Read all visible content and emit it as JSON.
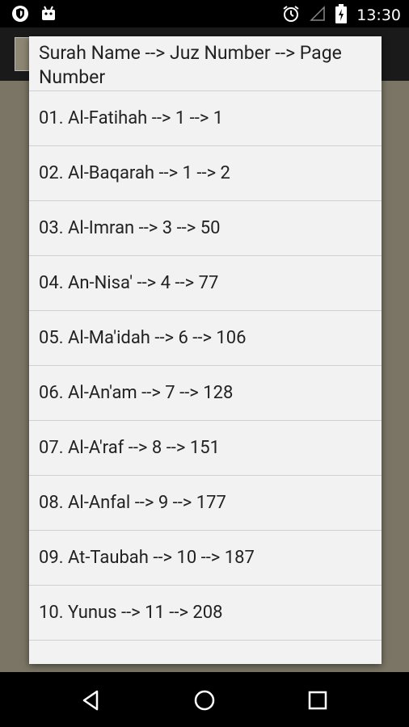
{
  "status_bar": {
    "time": "13:30",
    "left_icons": [
      "shield-icon",
      "android-icon"
    ],
    "right_icons": [
      "alarm-icon",
      "signal-icon",
      "battery-charging-icon"
    ]
  },
  "dialog": {
    "title": "Surah Name --> Juz Number --> Page Number",
    "items": [
      {
        "label": "01. Al-Fatihah --> 1 --> 1"
      },
      {
        "label": "02. Al-Baqarah --> 1 --> 2"
      },
      {
        "label": "03. Al-Imran --> 3 --> 50"
      },
      {
        "label": "04. An-Nisa' --> 4 --> 77"
      },
      {
        "label": "05. Al-Ma'idah --> 6 --> 106"
      },
      {
        "label": "06. Al-An'am --> 7 --> 128"
      },
      {
        "label": "07. Al-A'raf --> 8 --> 151"
      },
      {
        "label": "08. Al-Anfal --> 9 --> 177"
      },
      {
        "label": "09. At-Taubah --> 10 --> 187"
      },
      {
        "label": "10. Yunus --> 11 --> 208"
      }
    ]
  },
  "nav_bar": {
    "buttons": [
      "back-icon",
      "home-icon",
      "recents-icon"
    ]
  },
  "colors": {
    "background_dim": "#7a7565",
    "dialog_bg": "#f2f2f2",
    "divider": "#d0d0d0",
    "bars": "#000000"
  }
}
